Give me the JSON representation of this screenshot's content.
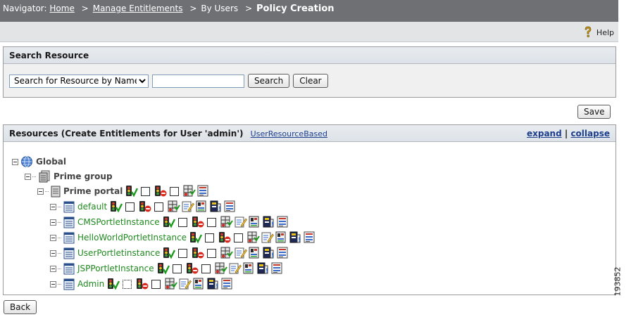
{
  "navigator": {
    "prefix": "Navigator:",
    "crumbs": [
      "Home",
      "Manage Entitlements",
      "By Users"
    ],
    "separator": ">",
    "current": "Policy Creation"
  },
  "help_label": "Help",
  "search": {
    "title": "Search Resource",
    "select_value": "Search for Resource by Name",
    "input_value": "",
    "search_label": "Search",
    "clear_label": "Clear"
  },
  "save_label": "Save",
  "resources": {
    "title": "Resources (Create Entitlements for User 'admin')",
    "link": "UserResourceBased",
    "expand": "expand",
    "divider": "|",
    "collapse": "collapse"
  },
  "tree": {
    "global": "Global",
    "group": "Prime group",
    "portal": "Prime portal",
    "instances": [
      "default",
      "CMSPortletInstance",
      "HelloWorldPortletInstance",
      "UserPortletinstance",
      "JSPPortletInstance",
      "Admin"
    ]
  },
  "back_label": "Back",
  "figure_number": "193852"
}
